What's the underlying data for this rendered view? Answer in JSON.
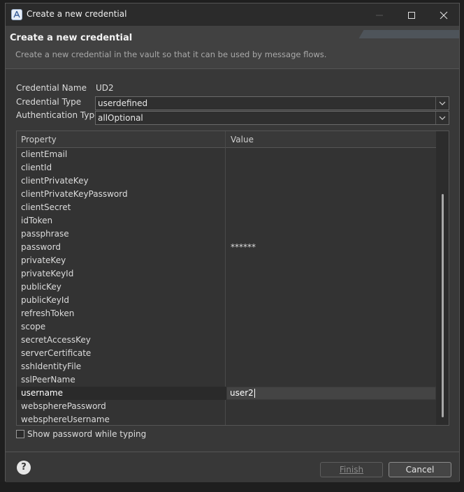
{
  "window": {
    "title": "Create a new credential"
  },
  "header": {
    "title": "Create a new credential",
    "description": "Create a new credential in the vault so that it can be used by message flows."
  },
  "form": {
    "name_label": "Credential Name",
    "name_value": "UD2",
    "type_label": "Credential Type",
    "type_value": "userdefined",
    "auth_label": "Authentication Type",
    "auth_value": "allOptional"
  },
  "table": {
    "headers": [
      "Property",
      "Value"
    ],
    "rows": [
      {
        "property": "clientEmail",
        "value": ""
      },
      {
        "property": "clientId",
        "value": ""
      },
      {
        "property": "clientPrivateKey",
        "value": ""
      },
      {
        "property": "clientPrivateKeyPassword",
        "value": ""
      },
      {
        "property": "clientSecret",
        "value": ""
      },
      {
        "property": "idToken",
        "value": ""
      },
      {
        "property": "passphrase",
        "value": ""
      },
      {
        "property": "password",
        "value": "******"
      },
      {
        "property": "privateKey",
        "value": ""
      },
      {
        "property": "privateKeyId",
        "value": ""
      },
      {
        "property": "publicKey",
        "value": ""
      },
      {
        "property": "publicKeyId",
        "value": ""
      },
      {
        "property": "refreshToken",
        "value": ""
      },
      {
        "property": "scope",
        "value": ""
      },
      {
        "property": "secretAccessKey",
        "value": ""
      },
      {
        "property": "serverCertificate",
        "value": ""
      },
      {
        "property": "sshIdentityFile",
        "value": ""
      },
      {
        "property": "sslPeerName",
        "value": ""
      },
      {
        "property": "username",
        "value": "user2"
      },
      {
        "property": "webspherePassword",
        "value": ""
      },
      {
        "property": "websphereUsername",
        "value": ""
      }
    ],
    "selected_row": 18
  },
  "options": {
    "show_password_label": "Show password while typing",
    "show_password_checked": false
  },
  "footer": {
    "finish_label": "Finish",
    "cancel_label": "Cancel"
  },
  "icons": [
    "app-icon",
    "minimize-icon",
    "maximize-icon",
    "close-icon",
    "chevron-down-icon",
    "help-icon",
    "checkbox-icon"
  ],
  "colors": {
    "window_bg": "#383838",
    "header_bg": "#414141",
    "table_bg": "#333333",
    "text": "#dcdcdc"
  }
}
